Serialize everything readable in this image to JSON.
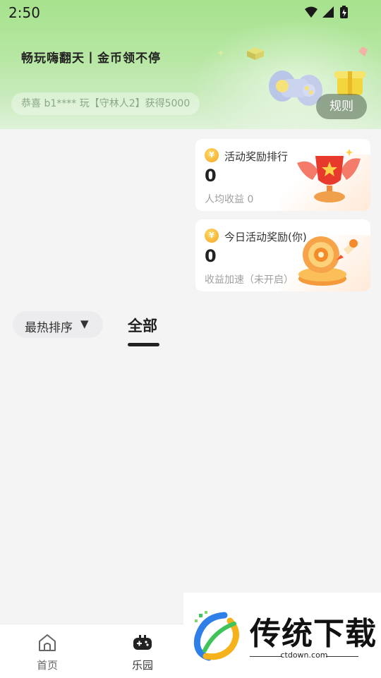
{
  "status_bar": {
    "time": "2:50"
  },
  "banner": {
    "slogan": "畅玩嗨翻天丨金币领不停",
    "ticker": "恭喜 b1**** 玩【守林人2】获得5000",
    "rules_label": "规则"
  },
  "cards": [
    {
      "title": "活动奖励排行",
      "value": "0",
      "subtitle": "人均收益 0",
      "coin_symbol": "¥"
    },
    {
      "title": "今日活动奖励(你)",
      "value": "0",
      "subtitle": "收益加速（未开启）",
      "coin_symbol": "¥"
    }
  ],
  "filters": {
    "sort_label": "最热排序",
    "sort_caret": "▼",
    "active_tab": "全部"
  },
  "bottom_nav": [
    {
      "label": "首页",
      "icon": "home-icon"
    },
    {
      "label": "乐园",
      "icon": "gamepad-icon"
    }
  ],
  "watermark": {
    "title": "传统下载",
    "domain": "ctdown.com"
  },
  "colors": {
    "header_green": "#a6e28d",
    "coin_gold": "#f4a623",
    "dark_text": "#222222"
  }
}
